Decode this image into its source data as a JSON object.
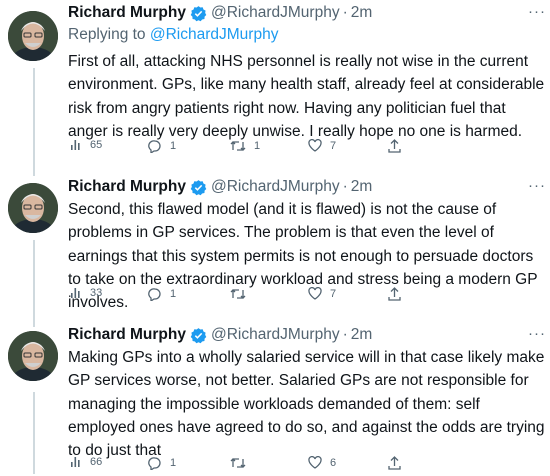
{
  "tweets": [
    {
      "author": "Richard Murphy",
      "handle": "@RichardJMurphy",
      "time": "2m",
      "replying_prefix": "Replying to ",
      "replying_handle": "@RichardJMurphy",
      "text": "First of all, attacking NHS personnel is really not wise in the current environment. GPs, like many health staff, already feel at considerable risk from angry patients right now. Having any politician fuel that anger is really very deeply unwise. I really hope no one is harmed.",
      "views": "65",
      "replies": "1",
      "retweets": "1",
      "likes": "7"
    },
    {
      "author": "Richard Murphy",
      "handle": "@RichardJMurphy",
      "time": "2m",
      "text": "Second, this flawed model (and it is flawed) is not the cause of problems in GP services. The problem is that even the level of earnings that this system permits is not enough to persuade doctors to take on the extraordinary workload and stress being a modern GP involves.",
      "views": "33",
      "replies": "1",
      "retweets": "",
      "likes": "7"
    },
    {
      "author": "Richard Murphy",
      "handle": "@RichardJMurphy",
      "time": "2m",
      "text": "Making GPs into a wholly salaried service will in that case likely make GP services worse, not better. Salaried GPs are not responsible for managing the impossible workloads demanded of them: self employed ones have agreed to do so, and against the odds are trying to do just that",
      "views": "66",
      "replies": "1",
      "retweets": "",
      "likes": "6"
    }
  ],
  "colors": {
    "text": "#0f1419",
    "secondary": "#536471",
    "link": "#1d9bf0",
    "verified": "#1d9bf0"
  },
  "icons": [
    "views-icon",
    "reply-icon",
    "retweet-icon",
    "like-icon",
    "share-icon",
    "verified-icon",
    "more-icon"
  ]
}
